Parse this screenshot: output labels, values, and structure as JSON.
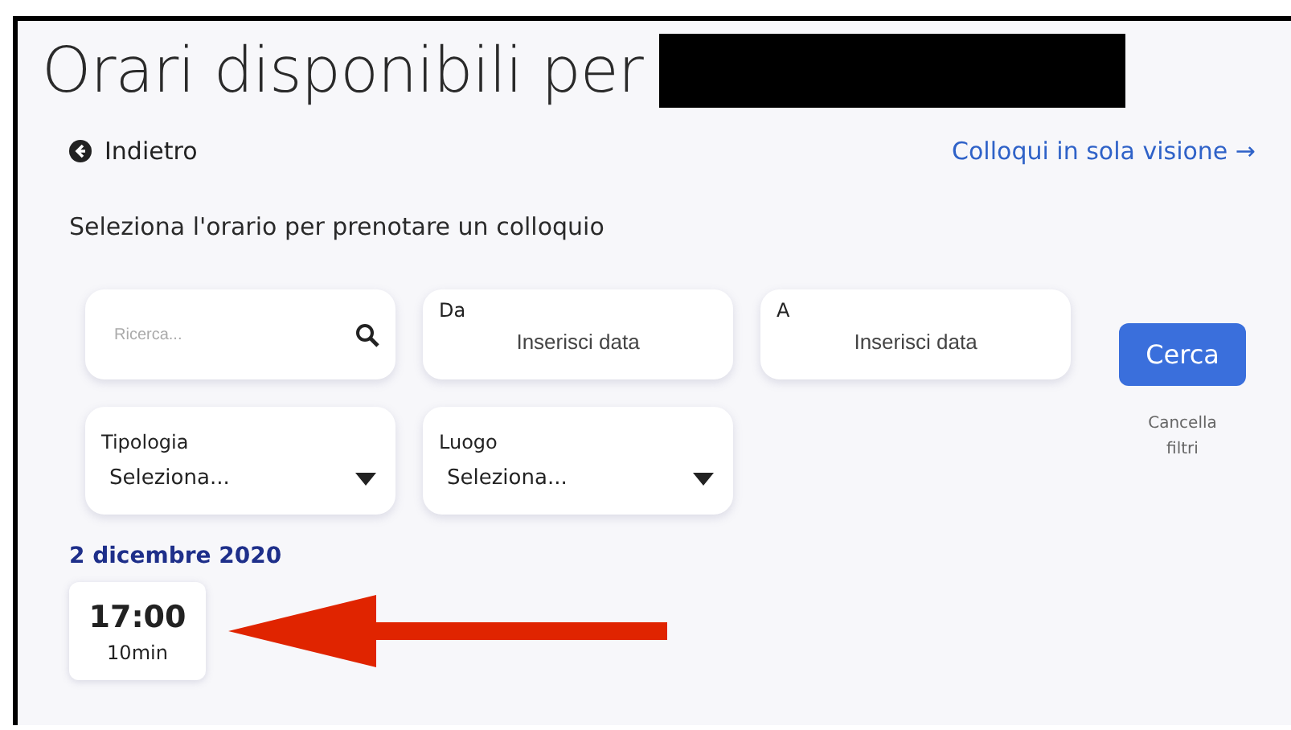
{
  "title": "Orari disponibili per",
  "back_link": {
    "label": "Indietro"
  },
  "view_only_link": {
    "label": "Colloqui in sola visione →"
  },
  "instruction": "Seleziona l'orario per prenotare un colloquio",
  "filters": {
    "search": {
      "placeholder": "Ricerca..."
    },
    "date_fields": [
      {
        "label": "Da",
        "placeholder": "Inserisci data"
      },
      {
        "label": "A",
        "placeholder": "Inserisci data"
      }
    ],
    "selects": [
      {
        "label": "Tipologia",
        "value": "Seleziona..."
      },
      {
        "label": "Luogo",
        "value": "Seleziona..."
      }
    ],
    "search_button": "Cerca",
    "clear_link": "Cancella filtri"
  },
  "days": [
    {
      "date": "2 dicembre 2020",
      "slots": [
        {
          "time": "17:00",
          "duration": "10min"
        }
      ]
    }
  ]
}
